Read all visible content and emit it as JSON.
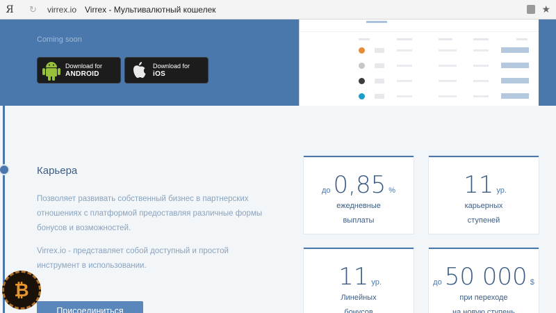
{
  "browser": {
    "logo": "Я",
    "url": "virrex.io",
    "title": "Virrex - Мультивалютный кошелек"
  },
  "hero": {
    "coming_soon": "Coming soon",
    "android": {
      "line1": "Download for",
      "line2": "ANDROID"
    },
    "ios": {
      "line1": "Download for",
      "line2": "iOS"
    },
    "screenshot_dot_colors": [
      "#e58b3a",
      "#c6c6c6",
      "#3c3c3c",
      "#1d9bc9"
    ]
  },
  "career": {
    "heading": "Карьера",
    "paragraph1": "Позволяет развивать собственный бизнес в партнерских отношениях с платформой предоставляя различные формы бонусов и возможностей.",
    "paragraph2": "Virrex.io - представляет собой доступный и простой инструмент в использовании.",
    "join_label": "Присоединиться"
  },
  "stats": [
    {
      "pre": "до",
      "value": "0,85",
      "post": "%",
      "line1": "ежедневные",
      "line2": "выплаты"
    },
    {
      "pre": "",
      "value": "11",
      "post": "ур.",
      "line1": "карьерных",
      "line2": "ступеней"
    },
    {
      "pre": "",
      "value": "11",
      "post": "ур.",
      "line1": "Линейных",
      "line2": "бонусов"
    },
    {
      "pre": "до",
      "value": "50 000",
      "post": "$",
      "line1": "при переходе",
      "line2": "на новую ступень"
    }
  ],
  "watermark": {
    "symbol": "₿"
  },
  "colors": {
    "brand": "#4a78ad",
    "text": "#3d5c82"
  }
}
